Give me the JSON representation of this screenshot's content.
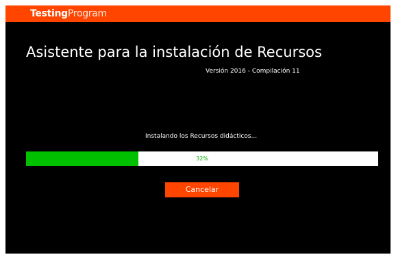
{
  "app": {
    "brand_bold": "Testing",
    "brand_light": "Program"
  },
  "installer": {
    "title": "Asistente para la instalación de Recursos",
    "version": "Versión 2016 - Compilación 11",
    "status": "Instalando los Recursos didácticos...",
    "progress_percent": 32,
    "progress_label": "32%",
    "cancel_label": "Cancelar"
  },
  "colors": {
    "accent": "#ff4500",
    "background": "#000000",
    "progress_fill": "#00c000",
    "progress_track": "#ffffff"
  }
}
